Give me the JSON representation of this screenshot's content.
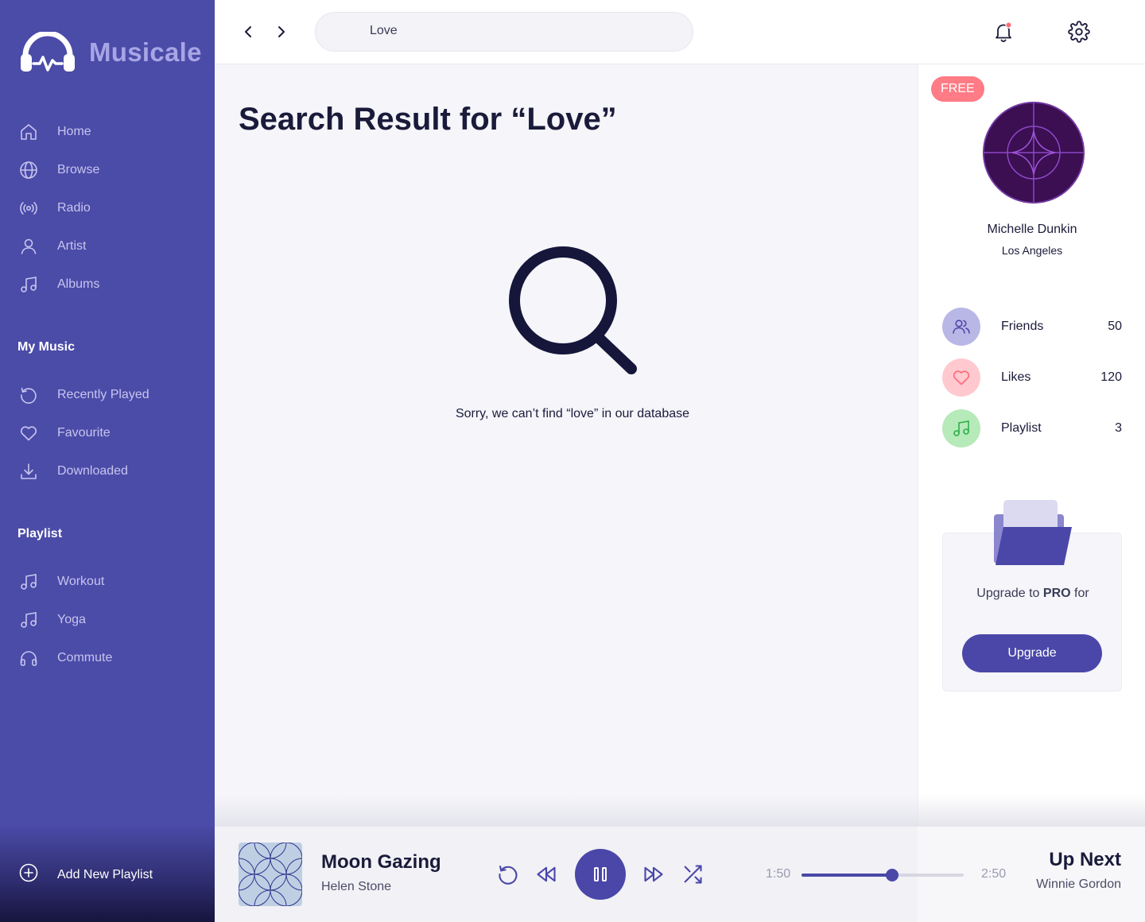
{
  "app": {
    "name": "Musicale"
  },
  "nav": {
    "items": [
      {
        "label": "Home",
        "icon": "home-icon"
      },
      {
        "label": "Browse",
        "icon": "globe-icon"
      },
      {
        "label": "Radio",
        "icon": "radio-icon"
      },
      {
        "label": "Artist",
        "icon": "user-icon"
      },
      {
        "label": "Albums",
        "icon": "music-note-icon"
      }
    ]
  },
  "my_music": {
    "title": "My Music",
    "items": [
      {
        "label": "Recently Played",
        "icon": "history-icon"
      },
      {
        "label": "Favourite",
        "icon": "heart-icon"
      },
      {
        "label": "Downloaded",
        "icon": "download-icon"
      }
    ]
  },
  "playlist": {
    "title": "Playlist",
    "items": [
      {
        "label": "Workout",
        "icon": "music-note-icon"
      },
      {
        "label": "Yoga",
        "icon": "music-note-icon"
      },
      {
        "label": "Commute",
        "icon": "headphones-icon"
      }
    ],
    "add_label": "Add New Playlist"
  },
  "search": {
    "value": "Love"
  },
  "main": {
    "title": "Search Result for “Love”",
    "empty_message": "Sorry, we can’t find “love” in our database"
  },
  "profile": {
    "badge": "FREE",
    "name": "Michelle Dunkin",
    "city": "Los Angeles",
    "stats": [
      {
        "label": "Friends",
        "value": "50",
        "icon": "friends-icon",
        "color": "#b9b7e6"
      },
      {
        "label": "Likes",
        "value": "120",
        "icon": "heart-icon",
        "color": "#ffc9cf"
      },
      {
        "label": "Playlist",
        "value": "3",
        "icon": "music-note-icon",
        "color": "#b6eab9"
      }
    ]
  },
  "promo": {
    "text_before": "Upgrade to",
    "text_bold": "PRO",
    "text_after": "for",
    "button": "Upgrade"
  },
  "player": {
    "title": "Moon Gazing",
    "artist": "Helen Stone",
    "current_time": "1:50",
    "total_time": "2:50",
    "progress": 0.56,
    "up_next_label": "Up Next",
    "up_next_artist": "Winnie Gordon"
  },
  "colors": {
    "sidebar": "#4b4ba8",
    "accent": "#4a47a8",
    "badge": "#ff7b86",
    "notification_dot": "#ff6b78"
  }
}
